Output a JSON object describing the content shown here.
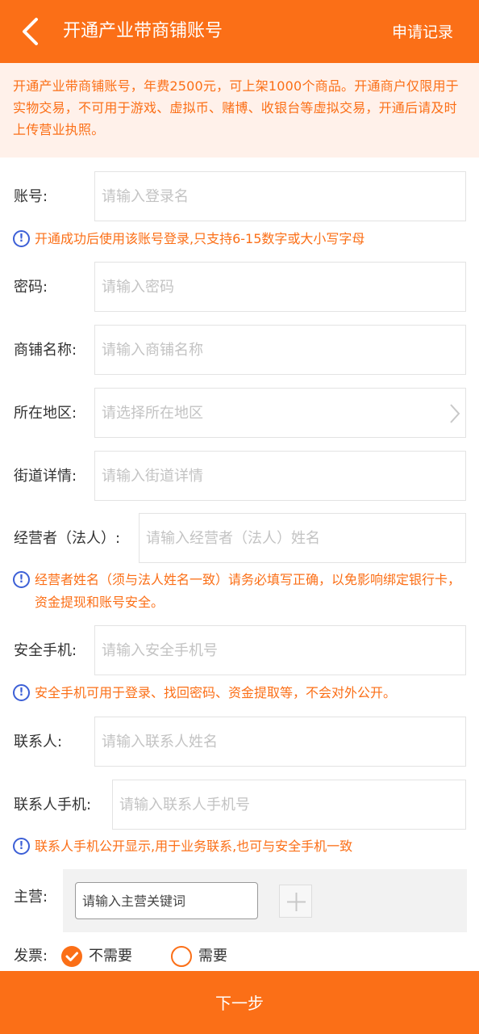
{
  "header": {
    "title": "开通产业带商铺账号",
    "right_link": "申请记录",
    "back_icon": "chevron-left-icon"
  },
  "notice": "开通产业带商铺账号，年费2500元，可上架1000个商品。开通商户仅限用于实物交易，不可用于游戏、虚拟币、赌博、收银台等虚拟交易，开通后请及时上传营业执照。",
  "form": {
    "account": {
      "label": "账号:",
      "placeholder": "请输入登录名"
    },
    "account_tip": "开通成功后使用该账号登录,只支持6-15数字或大小写字母",
    "password": {
      "label": "密码:",
      "placeholder": "请输入密码"
    },
    "shop_name": {
      "label": "商铺名称:",
      "placeholder": "请输入商铺名称"
    },
    "region": {
      "label": "所在地区:",
      "placeholder": "请选择所在地区"
    },
    "street": {
      "label": "街道详情:",
      "placeholder": "请输入街道详情"
    },
    "operator": {
      "label": "经营者（法人）:",
      "placeholder": "请输入经营者（法人）姓名"
    },
    "operator_tip": "经营者姓名（须与法人姓名一致）请务必填写正确，以免影响绑定银行卡，资金提现和账号安全。",
    "security_phone": {
      "label": "安全手机:",
      "placeholder": "请输入安全手机号"
    },
    "security_phone_tip": "安全手机可用于登录、找回密码、资金提取等，不会对外公开。",
    "contact": {
      "label": "联系人:",
      "placeholder": "请输入联系人姓名"
    },
    "contact_phone": {
      "label": "联系人手机:",
      "placeholder": "请输入联系人手机号"
    },
    "contact_phone_tip": "联系人手机公开显示,用于业务联系,也可与安全手机一致",
    "main_business": {
      "label": "主营:",
      "placeholder": "请输入主营关键词"
    },
    "invoice": {
      "label": "发票:",
      "option_no": "不需要",
      "option_yes": "需要",
      "selected": "不需要"
    }
  },
  "footer": {
    "next_label": "下一步"
  },
  "colors": {
    "accent": "#fb6f17",
    "notice_bg": "#fff1ea",
    "info_icon": "#3c5fd6"
  }
}
